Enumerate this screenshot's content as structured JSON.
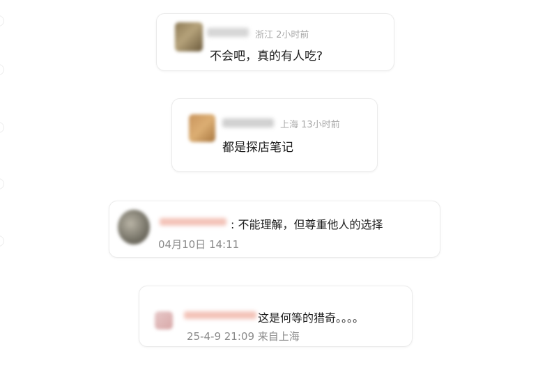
{
  "comments": [
    {
      "location": "浙江",
      "time": "2小时前",
      "text": "不会吧，真的有人吃?"
    },
    {
      "location": "上海",
      "time": "13小时前",
      "text": "都是探店笔记"
    },
    {
      "text": "不能理解，但尊重他人的选择",
      "separator": ":",
      "timestamp": "04月10日 14:11"
    },
    {
      "text": "这是何等的猎奇。。。。",
      "timestamp": "25-4-9 21:09",
      "source": "来自上海"
    }
  ]
}
